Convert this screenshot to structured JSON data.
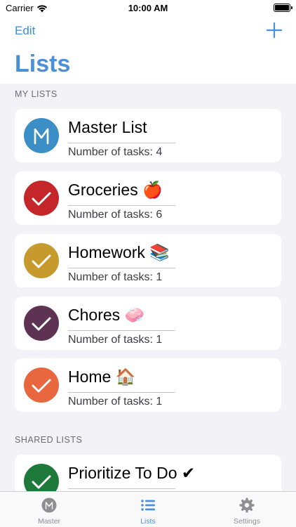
{
  "status_bar": {
    "carrier": "Carrier",
    "time": "10:00 AM"
  },
  "nav": {
    "edit_label": "Edit",
    "title": "Lists"
  },
  "sections": {
    "my_lists_header": "MY LISTS",
    "shared_lists_header": "SHARED LISTS"
  },
  "lists": [
    {
      "name": "Master List",
      "tasks": "Number of tasks: 4",
      "icon": "m-letter-icon",
      "color": "#3b8ec6"
    },
    {
      "name": "Groceries 🍎",
      "tasks": "Number of tasks: 6",
      "icon": "checkmark-icon",
      "color": "#c4262a"
    },
    {
      "name": "Homework 📚",
      "tasks": "Number of tasks: 1",
      "icon": "checkmark-icon",
      "color": "#c69a2c"
    },
    {
      "name": "Chores 🧼",
      "tasks": "Number of tasks: 1",
      "icon": "checkmark-icon",
      "color": "#5e3252"
    },
    {
      "name": "Home 🏠",
      "tasks": "Number of tasks: 1",
      "icon": "checkmark-icon",
      "color": "#e8673f"
    }
  ],
  "shared_lists": [
    {
      "name": "Prioritize To Do ✔",
      "icon": "checkmark-icon",
      "color": "#1e7a3a"
    }
  ],
  "tabs": [
    {
      "label": "Master",
      "icon": "m-letter-icon",
      "active": false
    },
    {
      "label": "Lists",
      "icon": "list-icon",
      "active": true
    },
    {
      "label": "Settings",
      "icon": "gear-icon",
      "active": false
    }
  ],
  "colors": {
    "accent": "#4a90d9",
    "background": "#f2f2f7"
  }
}
